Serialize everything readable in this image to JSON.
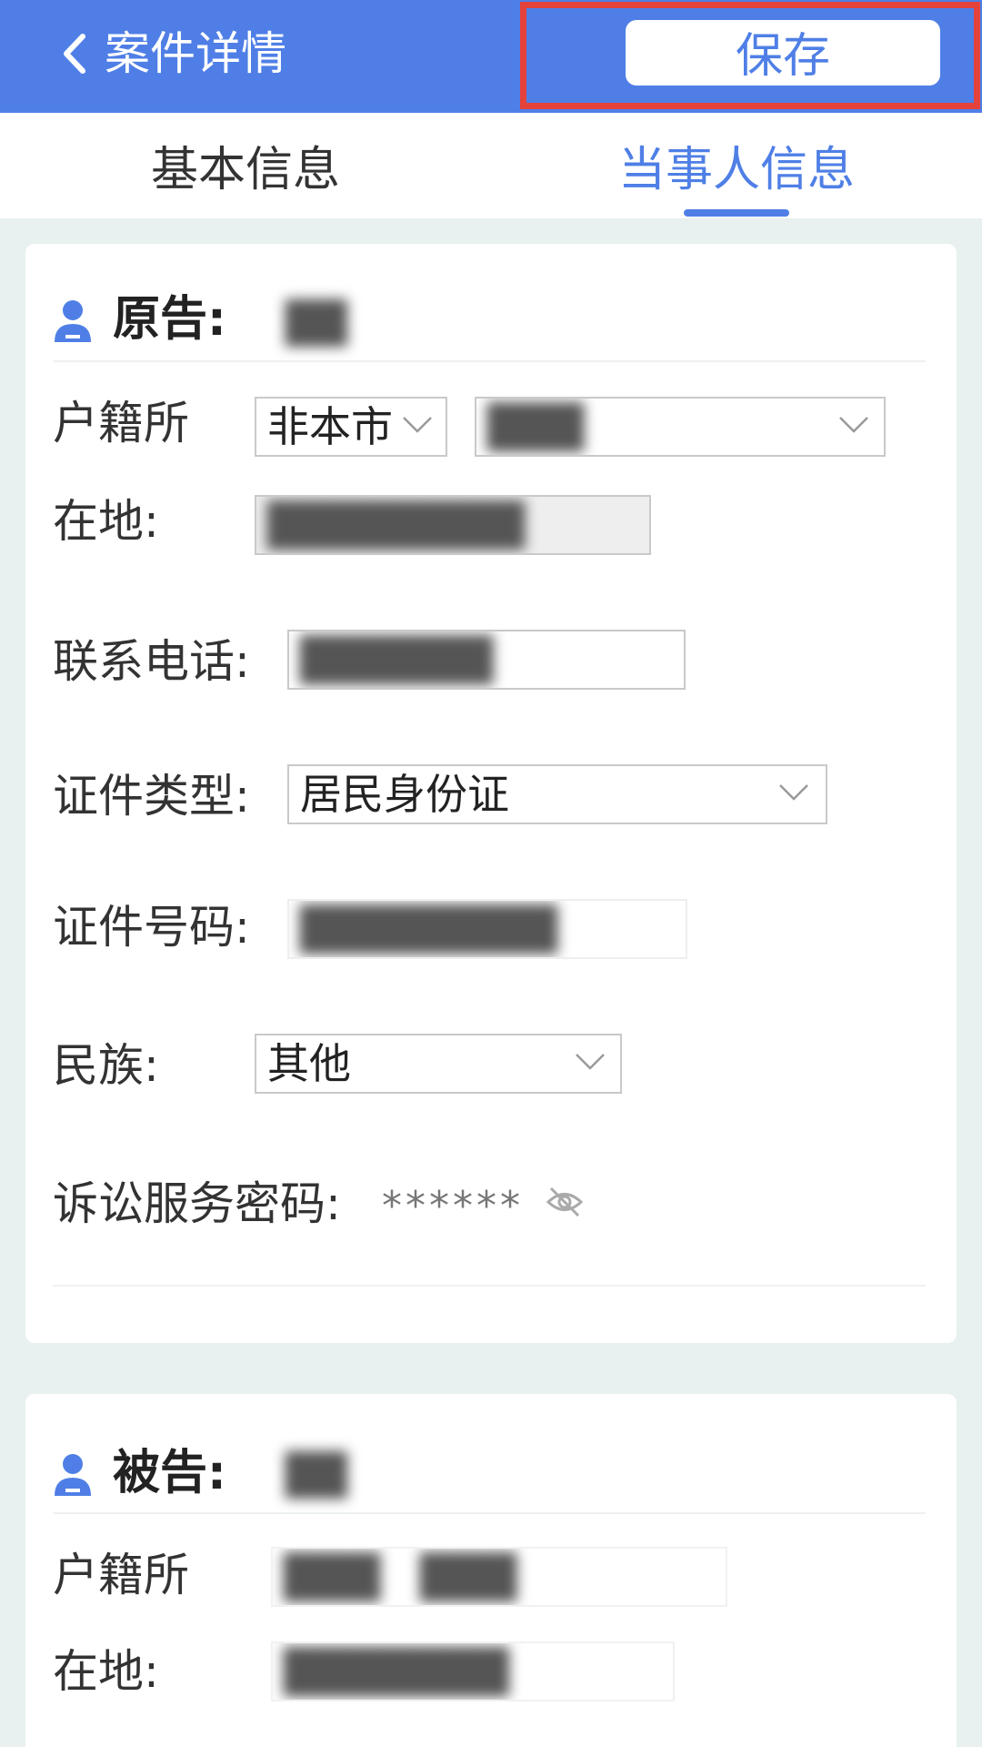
{
  "header": {
    "title": "案件详情",
    "save_label": "保存"
  },
  "tabs": [
    {
      "label": "基本信息",
      "active": false
    },
    {
      "label": "当事人信息",
      "active": true
    }
  ],
  "plaintiff": {
    "role_label": "原告:",
    "fields": {
      "household_label_line1": "户籍所",
      "household_label_line2": "在地:",
      "household_scope": "非本市",
      "phone_label": "联系电话:",
      "id_type_label": "证件类型:",
      "id_type_value": "居民身份证",
      "id_number_label": "证件号码:",
      "ethnicity_label": "民族:",
      "ethnicity_value": "其他",
      "password_label": "诉讼服务密码:",
      "password_value": "******"
    }
  },
  "defendant": {
    "role_label": "被告:",
    "fields": {
      "household_label_line1": "户籍所",
      "household_label_line2": "在地:"
    }
  },
  "colors": {
    "primary": "#4f7fe6",
    "highlight_border": "#e5423b",
    "page_bg": "#e9f0f0"
  }
}
